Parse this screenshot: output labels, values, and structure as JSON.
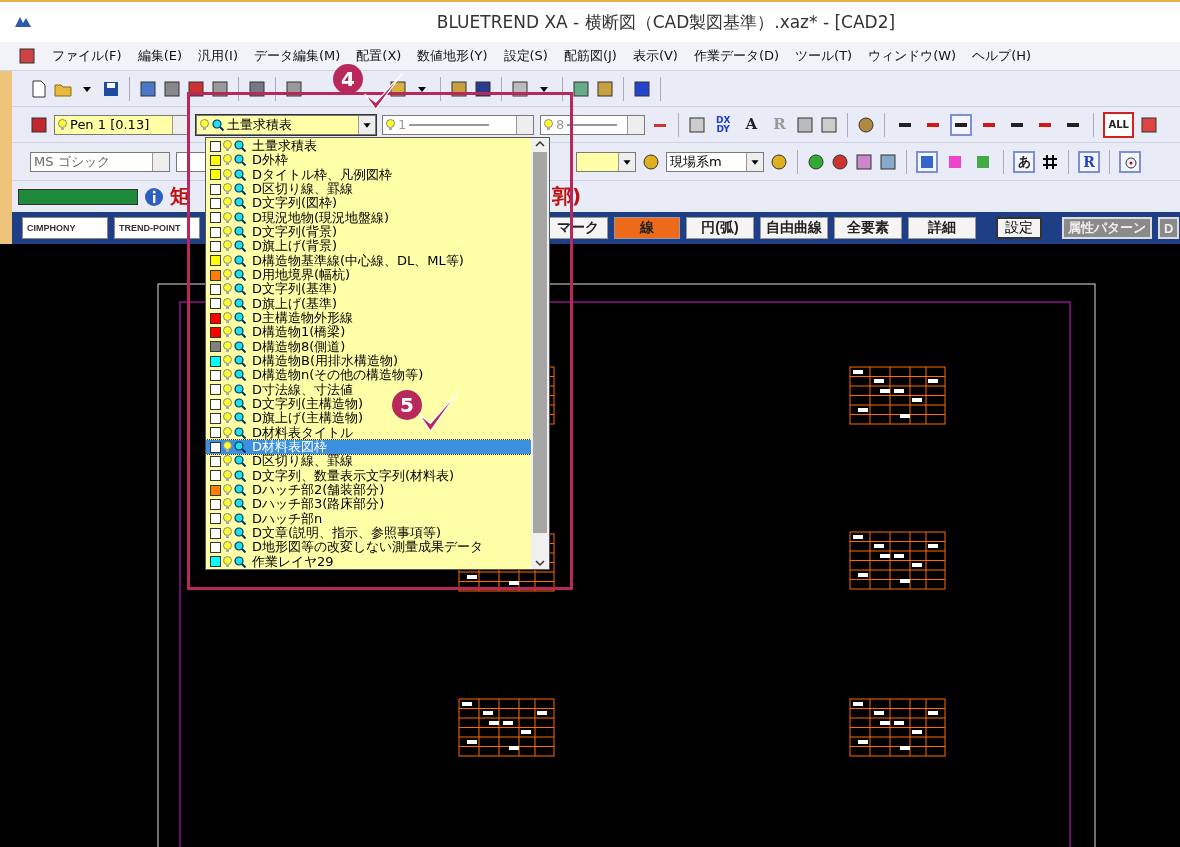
{
  "window": {
    "title": "BLUETREND XA - 横断図（CAD製図基準）.xaz* - [CAD2]"
  },
  "menu": [
    "ファイル(F)",
    "編集(E)",
    "汎用(I)",
    "データ編集(M)",
    "配置(X)",
    "数値地形(Y)",
    "設定(S)",
    "配筋図(J)",
    "表示(V)",
    "作業データ(D)",
    "ツール(T)",
    "ウィンドウ(W)",
    "ヘルプ(H)"
  ],
  "pen_combo": {
    "value": "Pen 1 [0.13]"
  },
  "layer_combo": {
    "value": "土量求積表",
    "expanded": true
  },
  "line_combo": {
    "value": "1"
  },
  "width_combo": {
    "value": "8"
  },
  "toolbar2_tools": [
    {
      "kind": "stack",
      "label": "DX",
      "sublabel": "DY",
      "disabled": false
    },
    {
      "kind": "letter",
      "label": "A",
      "disabled": false
    },
    {
      "kind": "letter",
      "label": "R",
      "disabled": true
    }
  ],
  "snap_tools": [
    {
      "pressed": false
    },
    {
      "pressed": false
    },
    {
      "pressed": true
    },
    {
      "pressed": false
    },
    {
      "pressed": false
    },
    {
      "pressed": false
    },
    {
      "pressed": false
    }
  ],
  "all_tool": {
    "label": "ALL"
  },
  "font_combo": {
    "value": "MS ゴシック"
  },
  "coord_combo": {
    "value": "現場系m"
  },
  "view_tools": [
    {
      "pressed": true
    },
    {
      "pressed": false
    },
    {
      "pressed": false
    }
  ],
  "char_tool": {
    "label": "あ",
    "pressed": true
  },
  "r_tool": {
    "label": "R",
    "pressed": true
  },
  "point_tool": {
    "pressed": true
  },
  "status": {
    "level": 1,
    "message": "矩",
    "message_tail": "郭)"
  },
  "logo_buttons": [
    "CIMPHONY",
    "TREND-POINT"
  ],
  "mode_tabs": [
    {
      "label": "マーク",
      "selected": false
    },
    {
      "label": "線",
      "selected": true
    },
    {
      "label": "円(弧)",
      "selected": false
    },
    {
      "label": "自由曲線",
      "selected": false
    },
    {
      "label": "全要素",
      "selected": false
    },
    {
      "label": "詳細",
      "selected": false
    }
  ],
  "settings_button": "設定",
  "pattern_buttons": [
    {
      "label": "属性パターン",
      "disabled": true
    },
    {
      "label": "D",
      "disabled": true
    }
  ],
  "layer_list": {
    "items": [
      {
        "name": "土量求積表",
        "color": "#ffffff",
        "selected": false
      },
      {
        "name": "D外枠",
        "color": "#ffff00",
        "selected": false
      },
      {
        "name": "Dタイトル枠、凡例図枠",
        "color": "#ffff00",
        "selected": false
      },
      {
        "name": "D区切り線、罫線",
        "color": "#ffffff",
        "selected": false
      },
      {
        "name": "D文字列(図枠)",
        "color": "#ffffff",
        "selected": false
      },
      {
        "name": "D現況地物(現況地盤線)",
        "color": "#ffffff",
        "selected": false
      },
      {
        "name": "D文字列(背景)",
        "color": "#ffffff",
        "selected": false
      },
      {
        "name": "D旗上げ(背景)",
        "color": "#ffffff",
        "selected": false
      },
      {
        "name": "D構造物基準線(中心線、DL、ML等)",
        "color": "#ffff00",
        "selected": false
      },
      {
        "name": "D用地境界(幅杭)",
        "color": "#ff8000",
        "selected": false
      },
      {
        "name": "D文字列(基準)",
        "color": "#ffffff",
        "selected": false
      },
      {
        "name": "D旗上げ(基準)",
        "color": "#ffffff",
        "selected": false
      },
      {
        "name": "D主構造物外形線",
        "color": "#ff0000",
        "selected": false
      },
      {
        "name": "D構造物1(橋梁)",
        "color": "#ff0000",
        "selected": false
      },
      {
        "name": "D構造物8(側道)",
        "color": "#808080",
        "selected": false
      },
      {
        "name": "D構造物B(用排水構造物)",
        "color": "#00ffff",
        "selected": false
      },
      {
        "name": "D構造物n(その他の構造物等)",
        "color": "#ffffff",
        "selected": false
      },
      {
        "name": "D寸法線、寸法値",
        "color": "#ffffff",
        "selected": false
      },
      {
        "name": "D文字列(主構造物)",
        "color": "#ffffff",
        "selected": false
      },
      {
        "name": "D旗上げ(主構造物)",
        "color": "#ffffff",
        "selected": false
      },
      {
        "name": "D材料表タイトル",
        "color": "#ffffff",
        "selected": false
      },
      {
        "name": "D材料表図枠",
        "color": "#ffffff",
        "selected": true
      },
      {
        "name": "D区切り線、罫線",
        "color": "#ffffff",
        "selected": false
      },
      {
        "name": "D文字列、数量表示文字列(材料表)",
        "color": "#ffffff",
        "selected": false
      },
      {
        "name": "Dハッチ部2(舗装部分)",
        "color": "#ff8000",
        "selected": false
      },
      {
        "name": "Dハッチ部3(路床部分)",
        "color": "#ffffff",
        "selected": false
      },
      {
        "name": "Dハッチ部n",
        "color": "#ffffff",
        "selected": false
      },
      {
        "name": "D文章(説明、指示、参照事項等)",
        "color": "#ffffff",
        "selected": false
      },
      {
        "name": "D地形図等の改変しない測量成果データ",
        "color": "#ffffff",
        "selected": false
      },
      {
        "name": "作業レイヤ29",
        "color": "#00ffff",
        "selected": false
      }
    ]
  },
  "steps": [
    {
      "number": "4"
    },
    {
      "number": "5"
    }
  ]
}
